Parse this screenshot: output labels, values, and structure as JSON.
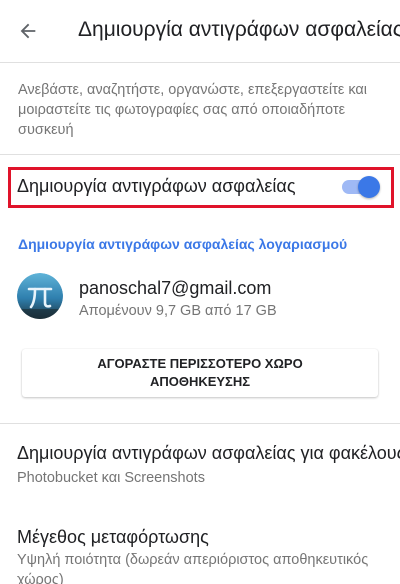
{
  "appbar": {
    "title": "Δημιουργία αντιγράφων ασφαλείας",
    "back_icon": "arrow-back-icon"
  },
  "intro": {
    "description": "Ανεβάστε, αναζητήστε, οργανώστε, επεξεργαστείτε και μοιραστείτε τις φωτογραφίες σας από οποιαδήποτε συσκευή"
  },
  "backup_toggle": {
    "label": "Δημιουργία αντιγράφων ασφαλείας",
    "enabled": true,
    "highlight_color": "#e0132a"
  },
  "account": {
    "section_title": "Δημιουργία αντιγράφων ασφαλείας λογαριασμού",
    "email": "panoschal7@gmail.com",
    "storage_text": "Απομένουν 9,7 GB από 17 GB",
    "avatar_icon": "pi-avatar"
  },
  "buy_storage": {
    "label": "ΑΓΟΡΑΣΤΕ ΠΕΡΙΣΣΟΤΕΡΟ ΧΩΡΟ ΑΠΟΘΗΚΕΥΣΗΣ"
  },
  "folders": {
    "title": "Δημιουργία αντιγράφων ασφαλείας για φακέλους συσκευής",
    "subtitle": "Photobucket και Screenshots"
  },
  "upload_size": {
    "title": "Μέγεθος μεταφόρτωσης",
    "subtitle": "Υψηλή ποιότητα (δωρεάν απεριόριστος αποθηκευτικός χώρος)"
  },
  "colors": {
    "accent": "#3b78e7",
    "toggle_track": "#9fb9f5"
  }
}
